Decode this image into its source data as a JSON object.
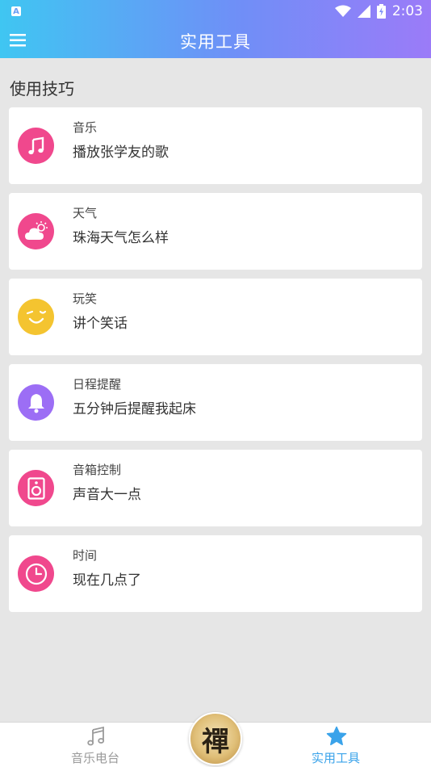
{
  "status_bar": {
    "time": "2:03",
    "app_badge": "A"
  },
  "toolbar": {
    "title": "实用工具",
    "menu_icon": "hamburger-menu-icon"
  },
  "section": {
    "title": "使用技巧"
  },
  "tips": [
    {
      "category": "音乐",
      "example": "播放张学友的歌",
      "icon": "music-note-icon",
      "color": "#f0488d"
    },
    {
      "category": "天气",
      "example": "珠海天气怎么样",
      "icon": "weather-cloud-icon",
      "color": "#f0488d"
    },
    {
      "category": "玩笑",
      "example": "讲个笑话",
      "icon": "smiley-wink-icon",
      "color": "#f4c430"
    },
    {
      "category": "日程提醒",
      "example": "五分钟后提醒我起床",
      "icon": "bell-icon",
      "color": "#9c6ef5"
    },
    {
      "category": "音箱控制",
      "example": "声音大一点",
      "icon": "speaker-icon",
      "color": "#f0488d"
    },
    {
      "category": "时间",
      "example": "现在几点了",
      "icon": "clock-icon",
      "color": "#f0488d"
    }
  ],
  "bottom_nav": {
    "radio": {
      "label": "音乐电台",
      "color": "#9a9a9a"
    },
    "center": {
      "glyph": "禪"
    },
    "tools": {
      "label": "实用工具",
      "color": "#3aa3ea"
    }
  }
}
